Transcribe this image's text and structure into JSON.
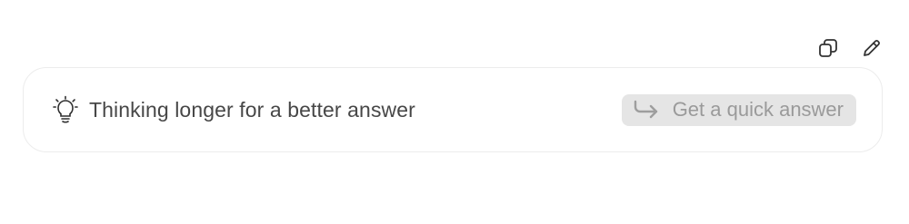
{
  "toolbar": {
    "copy_icon": "copy-icon",
    "edit_icon": "pencil-icon"
  },
  "status": {
    "icon": "lightbulb-icon",
    "text": "Thinking longer for a better answer",
    "quick_button": {
      "icon": "return-arrow-icon",
      "label": "Get a quick answer"
    }
  },
  "colors": {
    "card_border": "#ececec",
    "text": "#474747",
    "button_bg": "#e5e5e5",
    "button_text": "#9a9a9a"
  }
}
